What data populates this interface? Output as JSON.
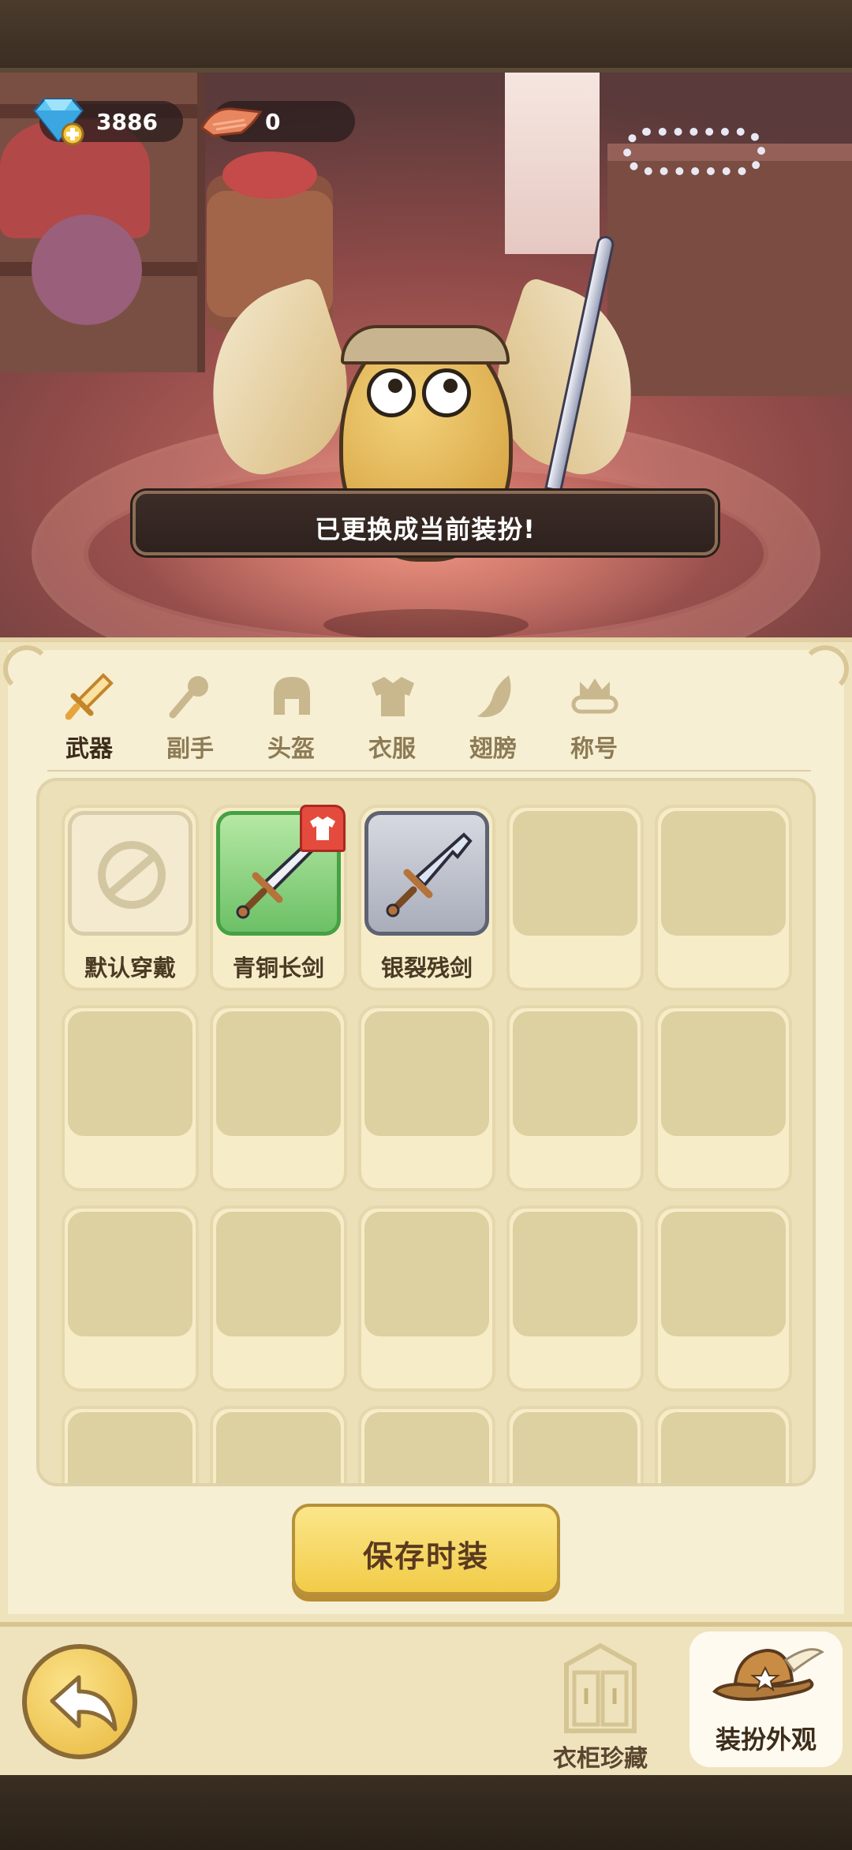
{
  "currency": {
    "gems": "3886",
    "cloth": "0"
  },
  "toast": {
    "message": "已更换成当前装扮!"
  },
  "tabs": [
    {
      "label": "武器",
      "icon": "sword-icon",
      "active": true
    },
    {
      "label": "副手",
      "icon": "offhand-icon",
      "active": false
    },
    {
      "label": "头盔",
      "icon": "helmet-icon",
      "active": false
    },
    {
      "label": "衣服",
      "icon": "armor-icon",
      "active": false
    },
    {
      "label": "翅膀",
      "icon": "wing-icon",
      "active": false
    },
    {
      "label": "称号",
      "icon": "title-icon",
      "active": false
    }
  ],
  "items": [
    {
      "name": "默认穿戴",
      "style": "default"
    },
    {
      "name": "青铜长剑",
      "style": "green",
      "equipped": true
    },
    {
      "name": "银裂残剑",
      "style": "silver"
    }
  ],
  "buttons": {
    "save": "保存时装"
  },
  "bottom_nav": {
    "wardrobe": "衣柜珍藏",
    "outfit": "装扮外观"
  },
  "colors": {
    "accent": "#c8892c",
    "panel": "#f6efd3",
    "rare_green": "#6cc066",
    "equipped_badge": "#e44b3d"
  }
}
